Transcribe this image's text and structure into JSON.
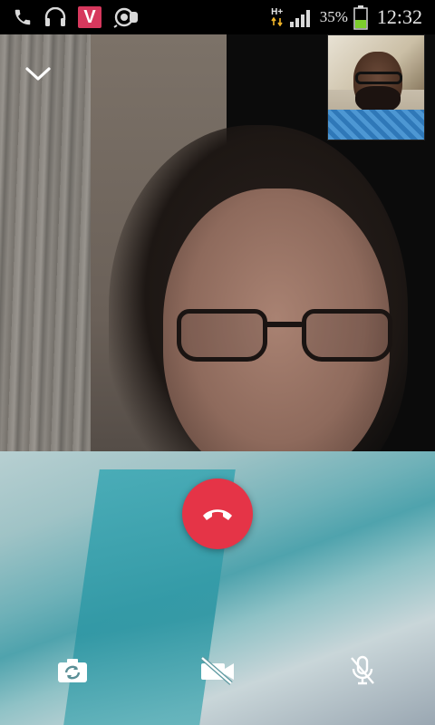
{
  "status_bar": {
    "network_type": "H+",
    "battery_percent": "35%",
    "time": "12:32",
    "notification_icons": [
      "phone-icon",
      "headset-icon",
      "v-app-icon",
      "voice-call-icon"
    ],
    "v_badge_label": "V",
    "battery_color": "#7ccd2d"
  },
  "call": {
    "end_call_color": "#e53447",
    "controls": [
      "switch-camera",
      "video-off",
      "mute-microphone"
    ]
  }
}
